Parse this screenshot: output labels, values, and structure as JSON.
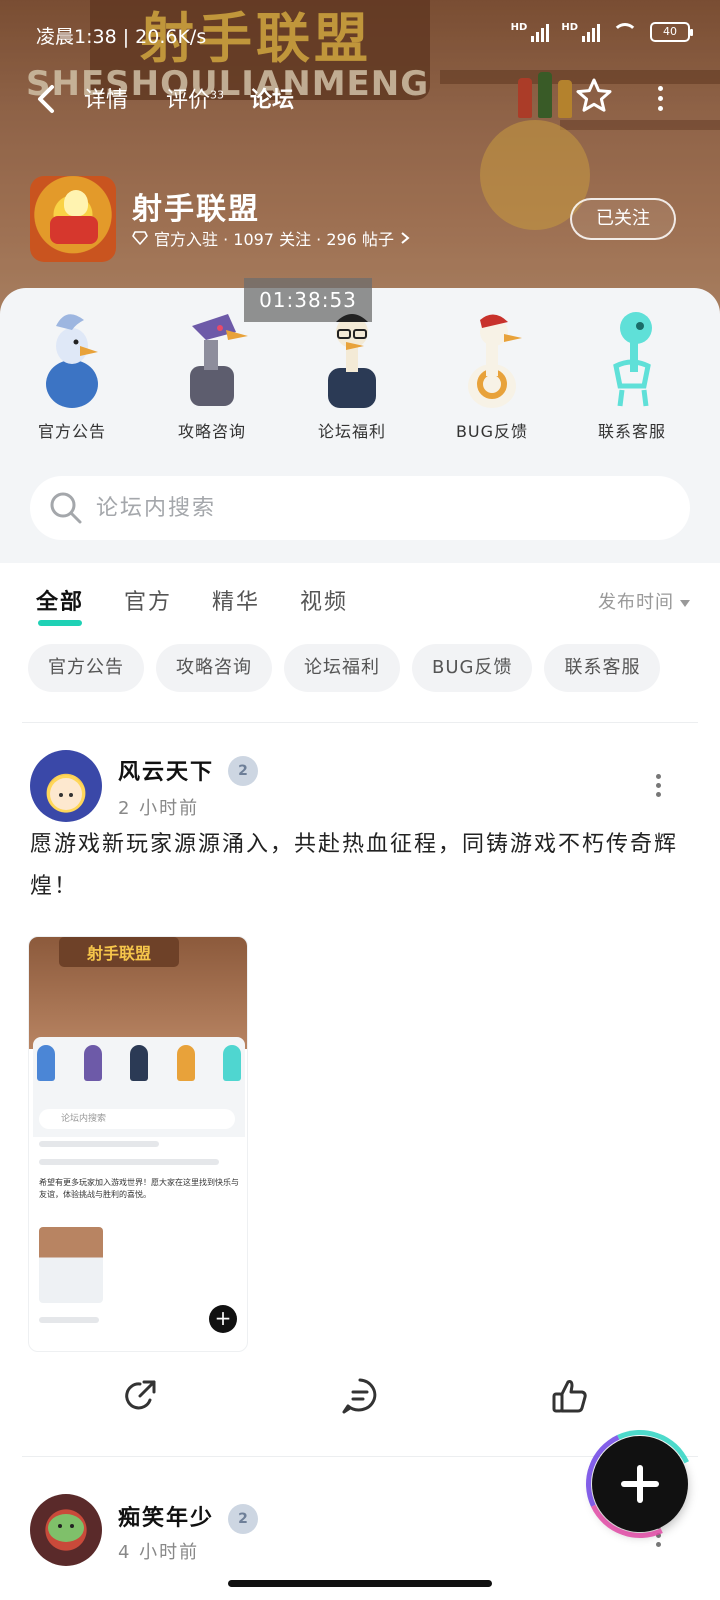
{
  "status_bar": {
    "time": "凌晨1:38 | 20.6K/s",
    "signal_1": "HD",
    "signal_2": "HD",
    "battery": "40"
  },
  "nav": {
    "tabs": [
      {
        "label": "详情"
      },
      {
        "label": "评价",
        "badge": "33"
      },
      {
        "label": "论坛"
      }
    ]
  },
  "banner": {
    "logo_cn": "射手联盟",
    "logo_en": "SHESHOULIANMENG"
  },
  "forum": {
    "name": "射手联盟",
    "meta": "官方入驻 · 1097 关注 · 296 帖子",
    "follow_label": "已关注"
  },
  "overlay_timer": "01:38:53",
  "sections": [
    {
      "label": "官方公告",
      "icon": "blue-bird-icon",
      "color": "#4b86d6"
    },
    {
      "label": "攻略咨询",
      "icon": "robot-bird-icon",
      "color": "#6d5aa8"
    },
    {
      "label": "论坛福利",
      "icon": "glasses-goose-icon",
      "color": "#2b3a55"
    },
    {
      "label": "BUG反馈",
      "icon": "goose-icon",
      "color": "#e8a23a"
    },
    {
      "label": "联系客服",
      "icon": "skeleton-icon",
      "color": "#4fd6d0"
    }
  ],
  "search": {
    "placeholder": "论坛内搜索"
  },
  "filter_tabs": [
    {
      "label": "全部"
    },
    {
      "label": "官方"
    },
    {
      "label": "精华"
    },
    {
      "label": "视频"
    }
  ],
  "sort_label": "发布时间",
  "chips": [
    "官方公告",
    "攻略咨询",
    "论坛福利",
    "BUG反馈",
    "联系客服"
  ],
  "posts": [
    {
      "author": "风云天下",
      "level": "2",
      "time": "2 小时前",
      "content": "愿游戏新玩家源源涌入，共赴热血征程，同铸游戏不朽传奇辉煌！",
      "image": {
        "sign_text": "射手联盟",
        "search_text": "论坛内搜索",
        "caption": "希望有更多玩家加入游戏世界！愿大家在这里找到快乐与友谊，体验挑战与胜利的喜悦。"
      }
    },
    {
      "author": "痴笑年少",
      "level": "2",
      "time": "4 小时前"
    }
  ],
  "colors": {
    "accent": "#1fd1b5",
    "banner": "#a67455"
  }
}
